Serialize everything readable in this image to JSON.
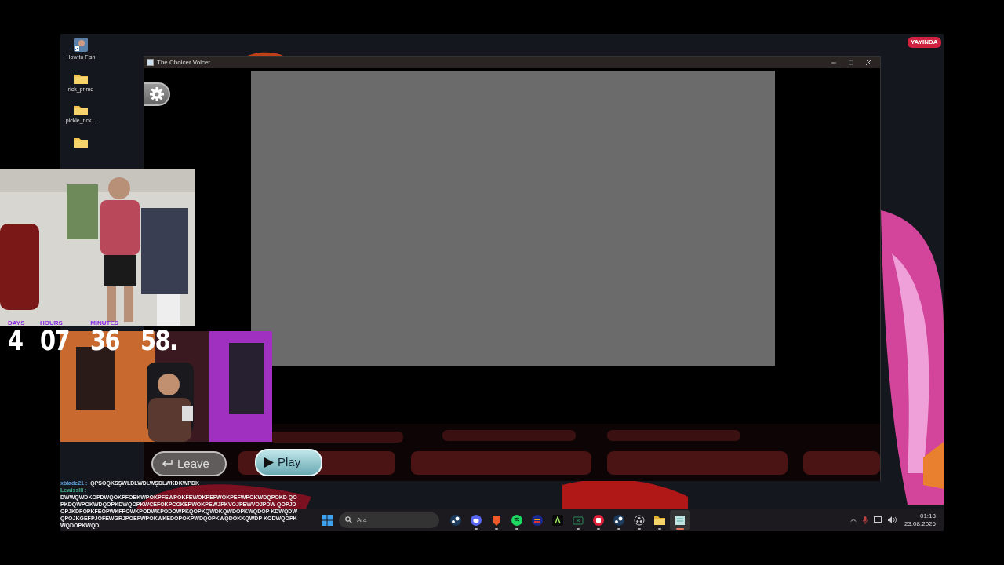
{
  "desktop": {
    "icons": [
      {
        "kind": "shortcut",
        "label": "How to Fish"
      },
      {
        "kind": "folder",
        "label": "rick_prime"
      },
      {
        "kind": "folder",
        "label": "pickle_rick..."
      },
      {
        "kind": "folder"
      }
    ]
  },
  "live_badge": "YAYINDA",
  "app_window": {
    "title": "The Choicer Voicer",
    "leave_button": "Leave",
    "play_button": "Play"
  },
  "countdown": [
    {
      "unit": "DAYS",
      "value": "4"
    },
    {
      "unit": "HOURS",
      "value": "07"
    },
    {
      "unit": "MINUTES",
      "value": "36"
    },
    {
      "value": "58."
    }
  ],
  "chat": [
    {
      "kind": "inline",
      "user": "xblade21 :",
      "color": "#5aa0e0",
      "message": "QPSOQKSŞWLDLWDLWŞDLWKDKWPDK"
    },
    {
      "kind": "block",
      "user": "Lewisslll :",
      "color": "#3fb08a",
      "message": "DWWQWDKOPDWQOKPFOEKWPOKPFEWPOKFEWOKPEFWOKPEFWPOKWDQPOKD QOPKDQWPOKWDQOPKDWQOPKWCEFOKPCOKEPWOKPEWJPKVOJPEWVOJPDW QOPJDOPJKDFOPKFEOPWKFPOWKPODWKPODOWPKQOPKQWDKQWDOPKWQDOP KDWQDWQPOJKGEFPJOFEWGRJPOEFWPOKWKEDOPOKPWDQOPKWQDOKKQWDP KODWQOPKWQDOPKWQDİ"
    }
  ],
  "taskbar": {
    "search_placeholder": "Ara",
    "apps": [
      {
        "kind": "steam",
        "running": false,
        "selected": false
      },
      {
        "kind": "chat",
        "running": true,
        "selected": false
      },
      {
        "kind": "shield",
        "running": true,
        "selected": false
      },
      {
        "kind": "music",
        "running": true,
        "selected": false
      },
      {
        "kind": "burger",
        "running": false,
        "selected": false
      },
      {
        "kind": "letter",
        "running": false,
        "selected": false
      },
      {
        "kind": "console",
        "running": true,
        "selected": false
      },
      {
        "kind": "red",
        "running": true,
        "selected": false
      },
      {
        "kind": "steam",
        "running": true,
        "selected": false
      },
      {
        "kind": "record",
        "running": true,
        "selected": false
      },
      {
        "kind": "folder",
        "running": true,
        "selected": false
      },
      {
        "kind": "notepad",
        "running": true,
        "selected": true
      }
    ]
  },
  "clock": {
    "time": "01:18",
    "date": "23.08.2026"
  }
}
